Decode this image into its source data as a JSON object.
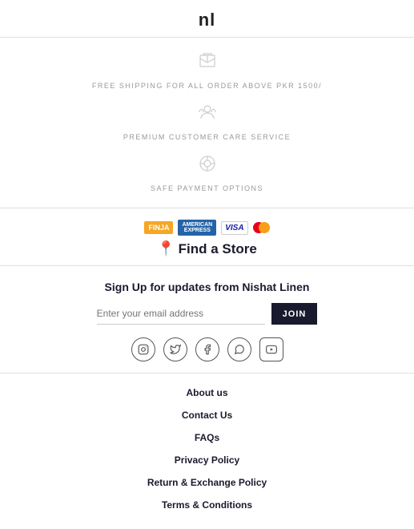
{
  "logo": {
    "text": "nl"
  },
  "features": [
    {
      "id": "shipping",
      "label": "FREE SHIPPING FOR ALL ORDER ABOVE PKR 1500/",
      "icon": "📦"
    },
    {
      "id": "customer-care",
      "label": "PREMIUM CUSTOMER CARE SERVICE",
      "icon": "👤"
    },
    {
      "id": "payment",
      "label": "SAFE PAYMENT OPTIONS",
      "icon": "🎯"
    }
  ],
  "payment": {
    "find_store_label": "Find a Store"
  },
  "signup": {
    "title": "Sign Up for updates from Nishat Linen",
    "placeholder": "Enter your email address",
    "button_label": "JOIN"
  },
  "social": [
    {
      "id": "instagram",
      "icon": "📷",
      "symbol": "▣"
    },
    {
      "id": "twitter",
      "icon": "𝕏",
      "symbol": "𝕏"
    },
    {
      "id": "facebook",
      "icon": "f",
      "symbol": "f"
    },
    {
      "id": "whatsapp",
      "icon": "✆",
      "symbol": "✆"
    },
    {
      "id": "youtube",
      "icon": "▶",
      "symbol": "▶"
    }
  ],
  "footer_links": [
    {
      "id": "about",
      "label": "About us"
    },
    {
      "id": "contact",
      "label": "Contact Us"
    },
    {
      "id": "faqs",
      "label": "FAQs"
    },
    {
      "id": "privacy",
      "label": "Privacy Policy"
    },
    {
      "id": "return",
      "label": "Return & Exchange Policy"
    },
    {
      "id": "terms",
      "label": "Terms & Conditions"
    }
  ]
}
